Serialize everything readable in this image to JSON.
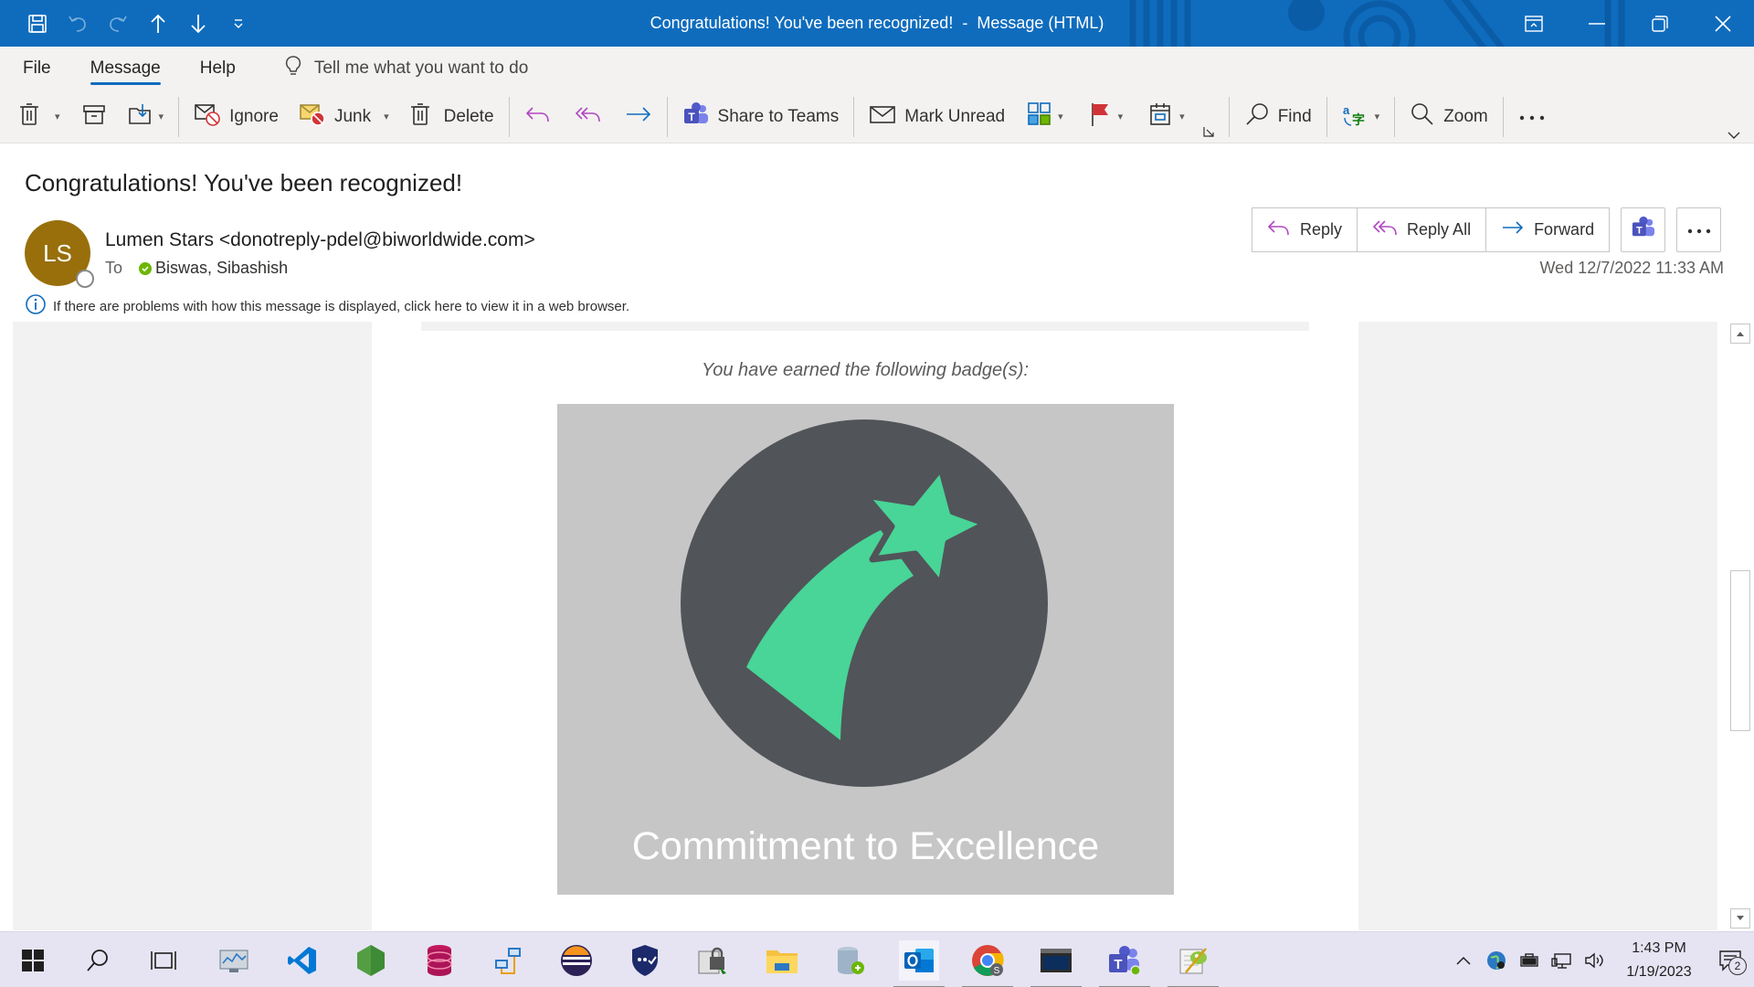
{
  "window": {
    "title": "Congratulations! You've been recognized!  -  Message (HTML)"
  },
  "menu": {
    "tabs": [
      "File",
      "Message",
      "Help"
    ],
    "active_tab": "Message",
    "tell_me": "Tell me what you want to do"
  },
  "ribbon": {
    "ignore": "Ignore",
    "junk": "Junk",
    "delete": "Delete",
    "share_to_teams": "Share to Teams",
    "mark_unread": "Mark Unread",
    "find": "Find",
    "zoom": "Zoom"
  },
  "message": {
    "subject": "Congratulations! You've been recognized!",
    "avatar_initials": "LS",
    "sender": "Lumen Stars <donotreply-pdel@biworldwide.com>",
    "to_label": "To",
    "recipient": "Biswas, Sibashish",
    "info": "If there are problems with how this message is displayed, click here to view it in a web browser.",
    "timestamp": "Wed 12/7/2022 11:33 AM",
    "actions": {
      "reply": "Reply",
      "reply_all": "Reply All",
      "forward": "Forward"
    }
  },
  "body": {
    "earned_text": "You have earned the following badge(s):",
    "badge_name": "Commitment to Excellence",
    "badge_colors": {
      "background": "#c6c6c6",
      "circle": "#515459",
      "star": "#48d597"
    }
  },
  "taskbar": {
    "apps": [
      "windows-start",
      "search",
      "task-view",
      "network-monitor",
      "visual-studio-code",
      "node-js",
      "database-tool",
      "network-config",
      "eclipse",
      "security-shield",
      "secure-file-tool",
      "file-explorer",
      "database-storage",
      "outlook",
      "chrome",
      "terminal",
      "teams",
      "notepad-plus-plus"
    ],
    "time": "1:43 PM",
    "date": "1/19/2023",
    "notifications": "2"
  },
  "colors": {
    "accent": "#0f6cbd",
    "ribbon_bg": "#f3f2f1",
    "avatar": "#986f0b"
  }
}
